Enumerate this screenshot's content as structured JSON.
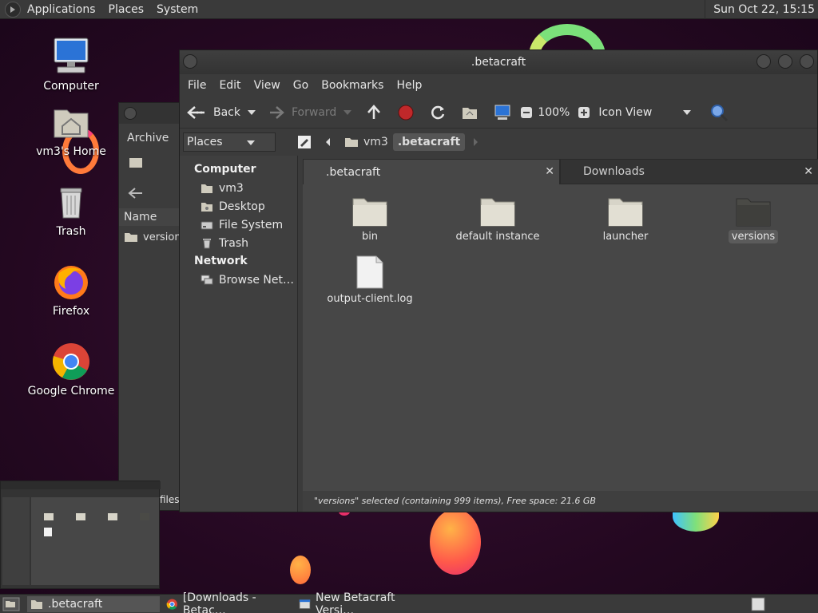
{
  "colors": {
    "panel": "#3a3a3a",
    "window": "#3b3b3b",
    "content": "#474747",
    "accent_folder": "#d7d4c8"
  },
  "top_panel": {
    "menus": [
      "Applications",
      "Places",
      "System"
    ],
    "clock": "Sun Oct 22, 15:15"
  },
  "desktop": {
    "icons": [
      {
        "label": "Computer",
        "icon": "computer-icon"
      },
      {
        "label": "vm3's Home",
        "icon": "home-folder-icon"
      },
      {
        "label": "Trash",
        "icon": "trash-icon"
      },
      {
        "label": "Firefox",
        "icon": "firefox-icon"
      },
      {
        "label": "Google Chrome",
        "icon": "chrome-icon"
      }
    ]
  },
  "back_window": {
    "title": "Archive",
    "column": "Name",
    "item": "version",
    "status": "files"
  },
  "window": {
    "title": ".betacraft",
    "menu": [
      "File",
      "Edit",
      "View",
      "Go",
      "Bookmarks",
      "Help"
    ],
    "toolbar": {
      "back": "Back",
      "forward": "Forward",
      "zoom": "100%",
      "view_mode": "Icon View"
    },
    "places_combo": "Places",
    "breadcrumb": [
      "vm3",
      ".betacraft"
    ],
    "sidebar": {
      "sections": [
        {
          "header": "Computer",
          "items": [
            {
              "label": "vm3",
              "icon": "home-icon"
            },
            {
              "label": "Desktop",
              "icon": "desktop-icon"
            },
            {
              "label": "File System",
              "icon": "drive-icon"
            },
            {
              "label": "Trash",
              "icon": "trash-icon"
            }
          ]
        },
        {
          "header": "Network",
          "items": [
            {
              "label": "Browse Net…",
              "icon": "network-icon"
            }
          ]
        }
      ]
    },
    "tabs": [
      {
        "label": ".betacraft",
        "active": true
      },
      {
        "label": "Downloads",
        "active": false
      }
    ],
    "files": [
      {
        "name": "bin",
        "type": "folder"
      },
      {
        "name": "default instance",
        "type": "folder"
      },
      {
        "name": "launcher",
        "type": "folder"
      },
      {
        "name": "versions",
        "type": "folder",
        "selected": true
      },
      {
        "name": "output-client.log",
        "type": "file"
      }
    ],
    "status": "\"versions\" selected (containing 999 items), Free space: 21.6 GB"
  },
  "taskbar": {
    "tasks": [
      {
        "label": ".betacraft",
        "active": true
      },
      {
        "label": "[Downloads - Betac…",
        "active": false
      },
      {
        "label": "New Betacraft Versi…",
        "active": false
      }
    ]
  }
}
